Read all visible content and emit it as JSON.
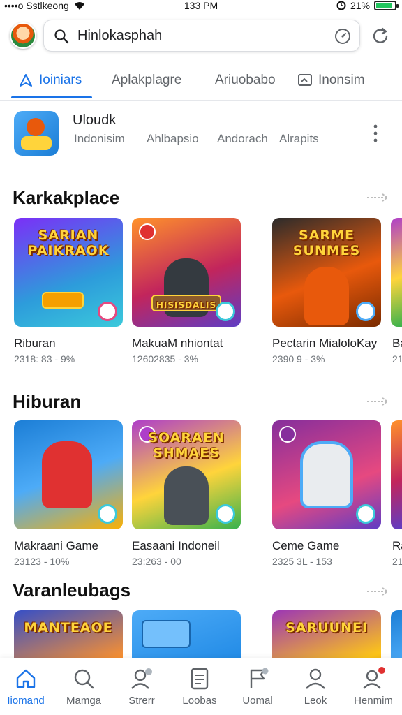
{
  "status_bar": {
    "carrier": "••••o Sstlkeong",
    "time": "133 PM",
    "battery": "21%",
    "battery_level": 0.9
  },
  "search": {
    "value": "Hinlokasphah"
  },
  "tabs": [
    {
      "label": "Ioiniars",
      "active": true,
      "icon": "play-triangle-icon"
    },
    {
      "label": "Aplakplagre",
      "active": false
    },
    {
      "label": "Ariuobabo",
      "active": false
    },
    {
      "label": "Inonsim",
      "active": false,
      "icon": "cast-icon"
    }
  ],
  "app_row": {
    "name": "Uloudk",
    "subs": [
      "Indonisim",
      "Ahlbapsio",
      "Andorach",
      "Alrapits"
    ]
  },
  "sections": [
    {
      "title": "Karkakplace",
      "cards": [
        {
          "name": "Riburan",
          "meta": "2318: 83 - 9%",
          "plate": "SARIAN PAIKRAOK"
        },
        {
          "name": "MakuaM nhiontat",
          "meta": "12602835 - 3%",
          "plate": "HISISDALIS"
        },
        {
          "name": "Pectarin MialoloKay",
          "meta": "2390 9 - 3%",
          "plate": "SARME SUNMES"
        },
        {
          "name": "Ba",
          "meta": "21"
        }
      ]
    },
    {
      "title": "Hiburan",
      "cards": [
        {
          "name": "Makraani Game",
          "meta": "23123 - 10%",
          "plate": ""
        },
        {
          "name": "Easaani Indoneil",
          "meta": "23:263 - 00",
          "plate": "SOARAEN SHMAES"
        },
        {
          "name": "Ceme Game",
          "meta": "2325 3L - 153",
          "plate": ""
        },
        {
          "name": "Ra",
          "meta": "21"
        }
      ]
    },
    {
      "title": "Varanleubags",
      "cards": [
        {
          "name": "",
          "meta": "",
          "plate": "MANTEAOE"
        },
        {
          "name": "",
          "meta": "",
          "plate": ""
        },
        {
          "name": "",
          "meta": "",
          "plate": "SARUUNEI"
        }
      ]
    }
  ],
  "bottom_nav": [
    {
      "label": "Iiomand",
      "icon": "home-icon",
      "active": true
    },
    {
      "label": "Mamga",
      "icon": "search-icon",
      "active": false
    },
    {
      "label": "Strerr",
      "icon": "person-badge-icon",
      "active": false
    },
    {
      "label": "Loobas",
      "icon": "document-icon",
      "active": false
    },
    {
      "label": "Uomal",
      "icon": "flag-icon",
      "active": false
    },
    {
      "label": "Leok",
      "icon": "person-icon",
      "active": false
    },
    {
      "label": "Henmim",
      "icon": "account-alert-icon",
      "active": false
    }
  ],
  "colors": {
    "accent": "#1a73e8",
    "text": "#202124",
    "muted": "#70757a",
    "badge": "#e03131"
  }
}
